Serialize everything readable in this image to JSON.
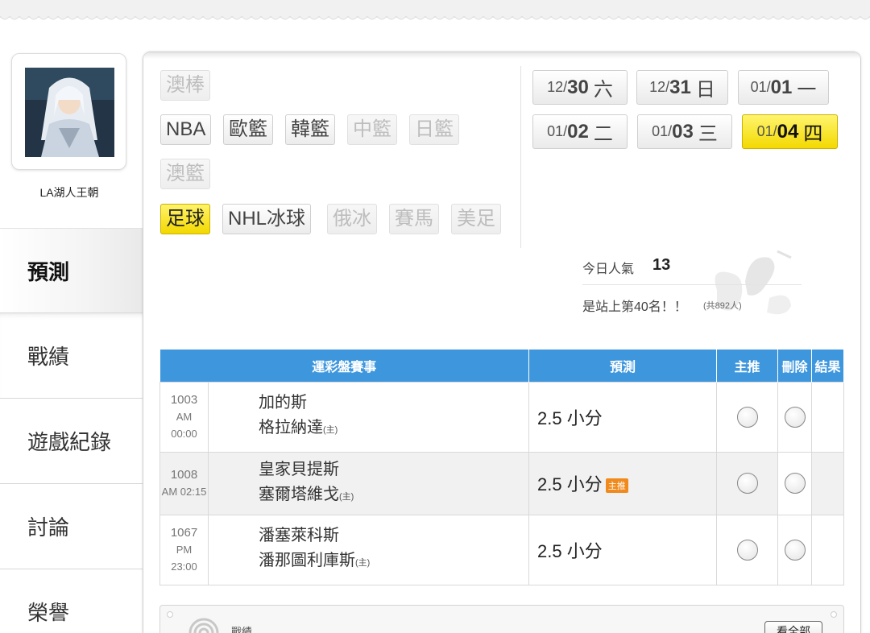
{
  "user": {
    "name": "LA湖人王朝"
  },
  "nav": {
    "items": [
      {
        "label": "預測"
      },
      {
        "label": "戰績"
      },
      {
        "label": "遊戲紀錄"
      },
      {
        "label": "討論"
      },
      {
        "label": "榮譽"
      }
    ]
  },
  "sports": {
    "row1": [
      {
        "label": "澳棒"
      }
    ],
    "row2": [
      {
        "label": "NBA"
      },
      {
        "label": "歐籃"
      },
      {
        "label": "韓籃"
      },
      {
        "label": "中籃"
      },
      {
        "label": "日籃"
      }
    ],
    "row3": [
      {
        "label": "澳籃"
      }
    ],
    "row4": [
      {
        "label": "足球"
      },
      {
        "label": "NHL冰球"
      },
      {
        "label": "俄冰"
      },
      {
        "label": "賽馬"
      },
      {
        "label": "美足"
      }
    ]
  },
  "dates": [
    {
      "md": "12/",
      "d": "30",
      "wd": "六"
    },
    {
      "md": "12/",
      "d": "31",
      "wd": "日"
    },
    {
      "md": "01/",
      "d": "01",
      "wd": "一"
    },
    {
      "md": "01/",
      "d": "02",
      "wd": "二"
    },
    {
      "md": "01/",
      "d": "03",
      "wd": "三"
    },
    {
      "md": "01/",
      "d": "04",
      "wd": "四"
    }
  ],
  "stats": {
    "popularity_label": "今日人氣",
    "popularity_value": "13",
    "rank_text": "是站上第40名！！",
    "rank_note": "(共892人)"
  },
  "table": {
    "headers": [
      "運彩盤賽事",
      "預測",
      "主推",
      "刪除",
      "結果"
    ],
    "rows": [
      {
        "no": "1003",
        "period": "AM",
        "time": "00:00",
        "team1": "加的斯",
        "team2": "格拉納達",
        "home_mark": "(主)",
        "prediction": "2.5 小分",
        "badge": ""
      },
      {
        "no": "1008",
        "period": "",
        "time": "AM 02:15",
        "team1": "皇家貝提斯",
        "team2": "塞爾塔維戈",
        "home_mark": "(主)",
        "prediction": "2.5 小分",
        "badge": "主推"
      },
      {
        "no": "1067",
        "period": "PM",
        "time": "23:00",
        "team1": "潘塞萊科斯",
        "team2": "潘那圖利庫斯",
        "home_mark": "(主)",
        "prediction": "2.5 小分",
        "badge": ""
      }
    ]
  },
  "bottom": {
    "title": "戰績",
    "see_all": "看全部"
  },
  "colors": {
    "header_blue": "#3e96dd",
    "selected_yellow": "#f6e000",
    "badge_orange": "#f08a1c"
  }
}
